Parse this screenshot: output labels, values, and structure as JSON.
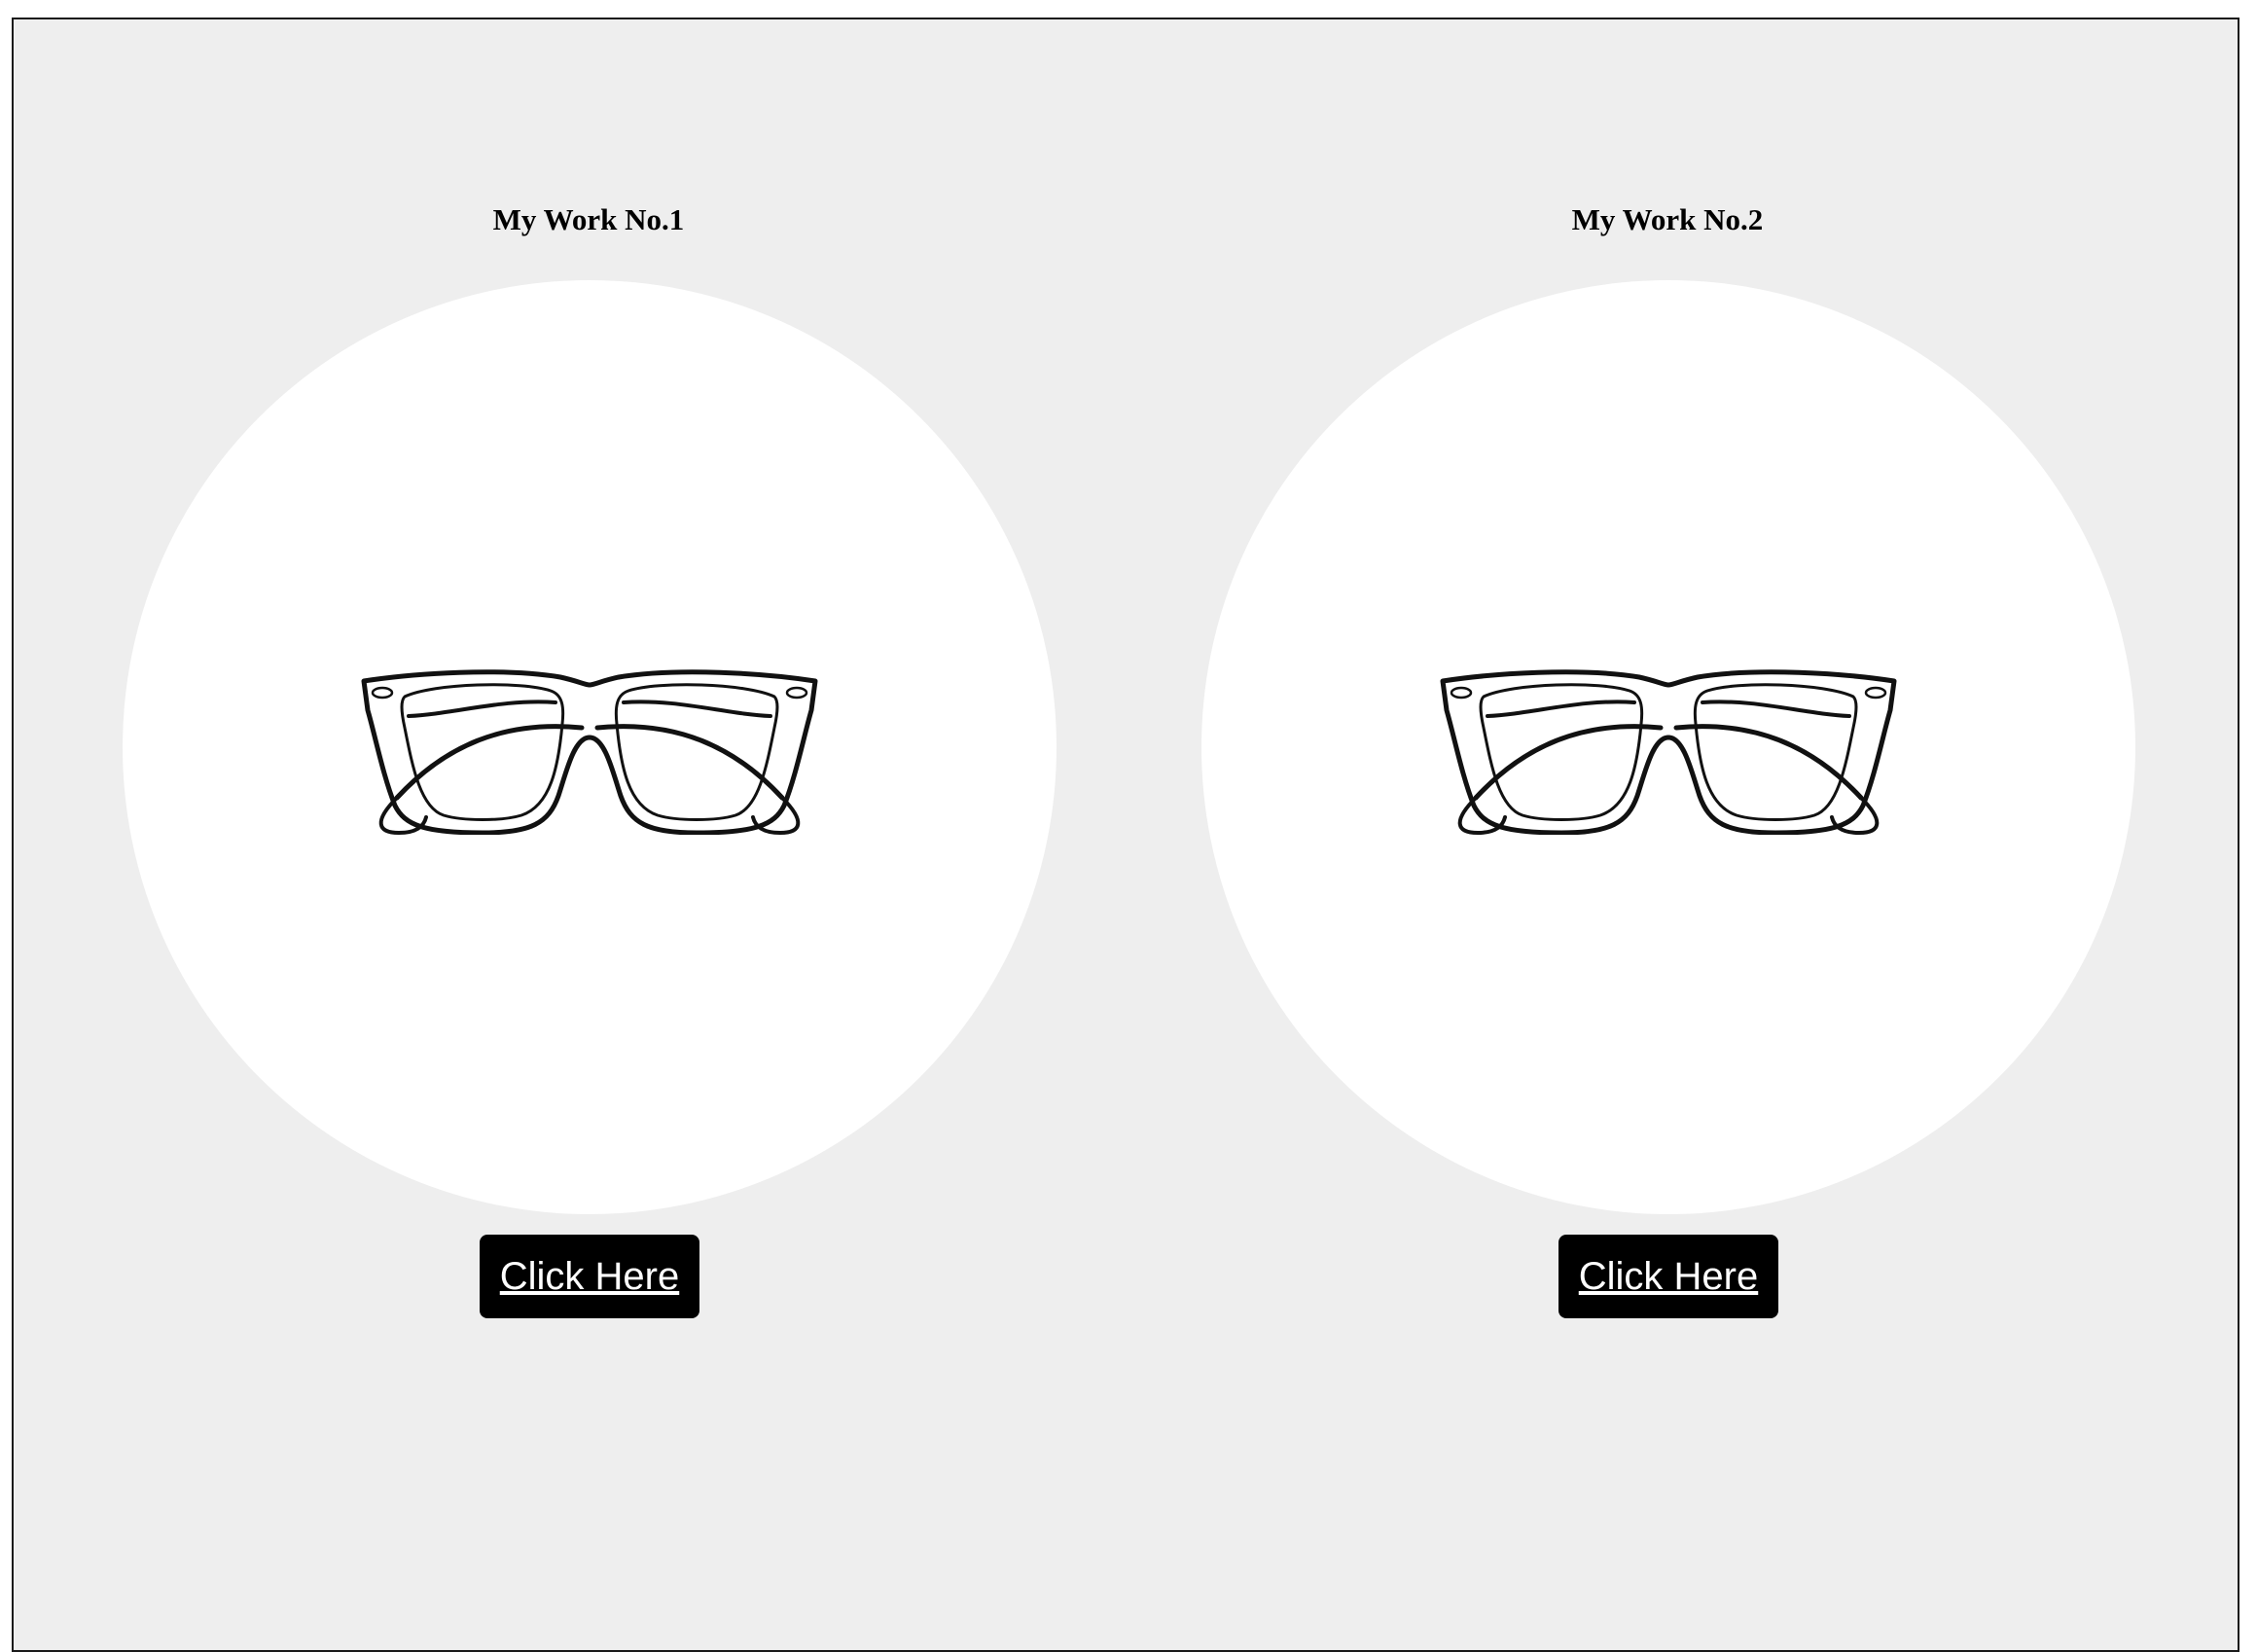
{
  "cards": [
    {
      "title": "My Work No.1",
      "button_label": "Click Here",
      "image": "glasses-icon"
    },
    {
      "title": "My Work No.2",
      "button_label": "Click Here",
      "image": "glasses-icon"
    }
  ],
  "colors": {
    "page_background": "#eeeeee",
    "circle": "#ffffff",
    "button": "#000000",
    "button_text": "#ffffff"
  }
}
